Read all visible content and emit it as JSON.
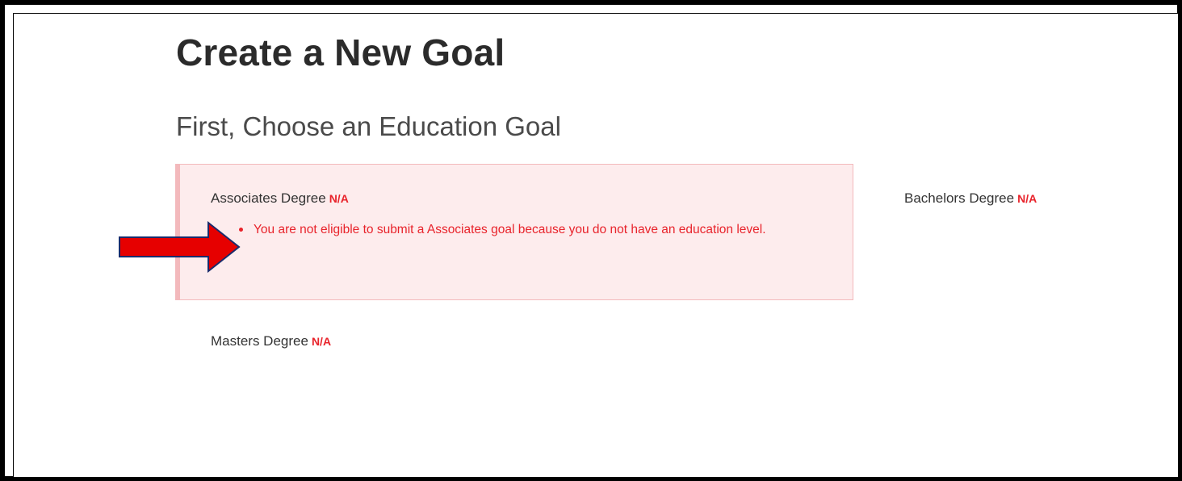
{
  "page": {
    "title": "Create a New Goal",
    "subtitle": "First, Choose an Education Goal"
  },
  "goals": [
    {
      "label": "Associates Degree",
      "status": "N/A",
      "errors": [
        "You are not eligible to submit a Associates goal because you do not have an education level."
      ]
    },
    {
      "label": "Bachelors Degree",
      "status": "N/A"
    },
    {
      "label": "Masters Degree",
      "status": "N/A"
    }
  ],
  "colors": {
    "error_text": "#e8232b",
    "error_background": "#fdeced",
    "error_border": "#f3b9bc",
    "annotation_arrow": "#e60000"
  },
  "annotation": {
    "icon": "red-arrow-icon"
  }
}
